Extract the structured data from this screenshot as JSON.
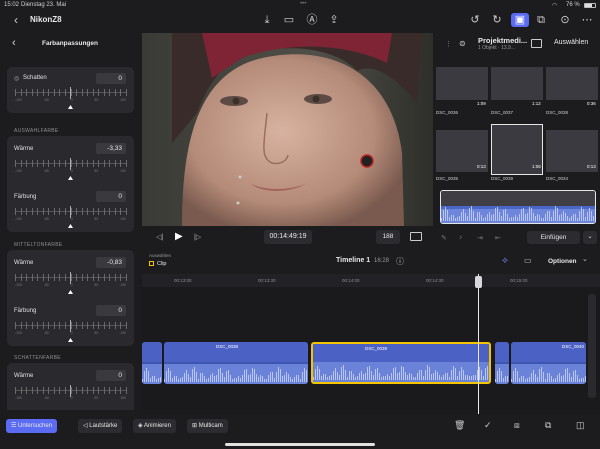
{
  "status": {
    "time": "15:02",
    "date": "Dienstag 23. Mai",
    "battery": "76 %"
  },
  "project": {
    "title": "NikonZ8"
  },
  "inspector": {
    "title": "Farbanpassungen",
    "shadows_row": {
      "label": "Schatten",
      "value": "0"
    },
    "sections": [
      {
        "label": "AUSWAHLFARBE",
        "rows": [
          {
            "label": "Wärme",
            "value": "-3,33"
          },
          {
            "label": "Färbung",
            "value": "0"
          }
        ]
      },
      {
        "label": "MITTELTONFARBE",
        "rows": [
          {
            "label": "Wärme",
            "value": "-0,83"
          },
          {
            "label": "Färbung",
            "value": "0"
          }
        ]
      },
      {
        "label": "SCHATTENFARBE",
        "rows": [
          {
            "label": "Wärme",
            "value": "0"
          }
        ]
      }
    ],
    "tick_labels": [
      "-100",
      "-50",
      "0",
      "50",
      "100"
    ]
  },
  "viewer": {
    "timecode": "00:14:49:19",
    "zoom": "188"
  },
  "browser": {
    "title": "Projektmedi...",
    "subtitle": "1 Objekt · 13,9...",
    "select_label": "Auswählen",
    "insert_label": "Einfügen",
    "thumbs": [
      {
        "name": "DSC_0036",
        "duration": "1:09"
      },
      {
        "name": "DSC_0037",
        "duration": "1:12"
      },
      {
        "name": "DSC_0038",
        "duration": "0:36"
      },
      {
        "name": "DSC_0035",
        "duration": "0:13"
      },
      {
        "name": "DSC_0039",
        "duration": "1:06"
      },
      {
        "name": "DSC_0034",
        "duration": "0:13"
      }
    ]
  },
  "timeline": {
    "select_label": "Auswählen",
    "clip_label": "Clip",
    "name": "Timeline 1",
    "duration": "16:28",
    "options_label": "Optionen",
    "ruler": [
      "00:13:00",
      "00:13:30",
      "00:14:00",
      "00:14:30",
      "00:15:00"
    ],
    "clips": [
      "DSC_0038",
      "DSC_0039",
      "DSC_0040"
    ]
  },
  "bottom": {
    "inspect": "Untersuchen",
    "volume": "Lautstärke",
    "animate": "Animieren",
    "multicam": "Multicam"
  },
  "colors": {
    "accent": "#5b6cf2",
    "clip": "#4b62c4",
    "selection": "#f5c400"
  }
}
